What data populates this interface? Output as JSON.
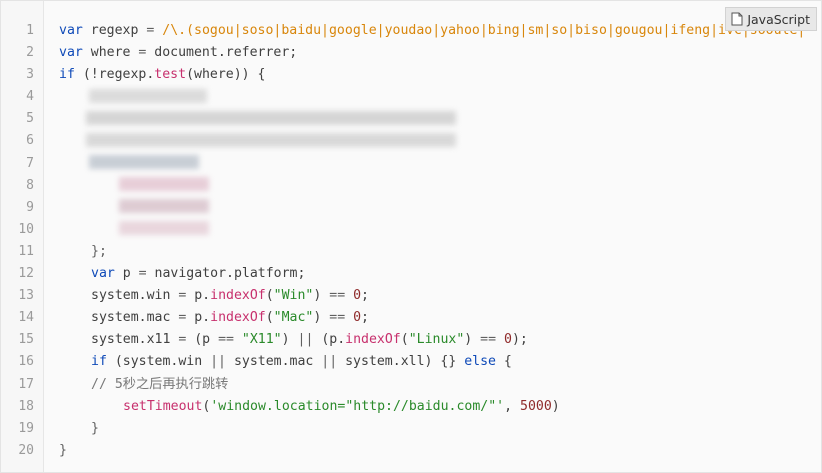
{
  "language_tag": {
    "label": "JavaScript",
    "icon": "document-icon"
  },
  "lines": [
    {
      "num": "1",
      "tokens": [
        {
          "t": "var",
          "c": "kw"
        },
        {
          "t": " regexp "
        },
        {
          "t": "=",
          "c": "op"
        },
        {
          "t": " "
        },
        {
          "t": "/\\.(sogou|soso|baidu|google|youdao|yahoo|bing|sm|so|biso|gougou|ifeng|ivc|sooule|",
          "c": "re"
        }
      ]
    },
    {
      "num": "2",
      "tokens": [
        {
          "t": "var",
          "c": "kw"
        },
        {
          "t": " where "
        },
        {
          "t": "=",
          "c": "op"
        },
        {
          "t": " document.referrer;"
        }
      ]
    },
    {
      "num": "3",
      "tokens": [
        {
          "t": "if",
          "c": "kw"
        },
        {
          "t": " (!regexp."
        },
        {
          "t": "test",
          "c": "fn"
        },
        {
          "t": "(where)) {"
        }
      ]
    },
    {
      "num": "4",
      "tokens": []
    },
    {
      "num": "5",
      "tokens": []
    },
    {
      "num": "6",
      "tokens": []
    },
    {
      "num": "7",
      "tokens": []
    },
    {
      "num": "8",
      "tokens": []
    },
    {
      "num": "9",
      "tokens": []
    },
    {
      "num": "10",
      "tokens": []
    },
    {
      "num": "11",
      "indent": 1,
      "tokens": [
        {
          "t": "};",
          "c": "op"
        }
      ]
    },
    {
      "num": "12",
      "indent": 1,
      "tokens": [
        {
          "t": "var",
          "c": "kw"
        },
        {
          "t": " p "
        },
        {
          "t": "=",
          "c": "op"
        },
        {
          "t": " navigator.platform;"
        }
      ]
    },
    {
      "num": "13",
      "indent": 1,
      "tokens": [
        {
          "t": "system.win "
        },
        {
          "t": "=",
          "c": "op"
        },
        {
          "t": " p."
        },
        {
          "t": "indexOf",
          "c": "fn"
        },
        {
          "t": "("
        },
        {
          "t": "\"Win\"",
          "c": "str"
        },
        {
          "t": ") "
        },
        {
          "t": "==",
          "c": "op"
        },
        {
          "t": " "
        },
        {
          "t": "0",
          "c": "num"
        },
        {
          "t": ";"
        }
      ]
    },
    {
      "num": "14",
      "indent": 1,
      "tokens": [
        {
          "t": "system.mac "
        },
        {
          "t": "=",
          "c": "op"
        },
        {
          "t": " p."
        },
        {
          "t": "indexOf",
          "c": "fn"
        },
        {
          "t": "("
        },
        {
          "t": "\"Mac\"",
          "c": "str"
        },
        {
          "t": ") "
        },
        {
          "t": "==",
          "c": "op"
        },
        {
          "t": " "
        },
        {
          "t": "0",
          "c": "num"
        },
        {
          "t": ";"
        }
      ]
    },
    {
      "num": "15",
      "indent": 1,
      "tokens": [
        {
          "t": "system.x11 "
        },
        {
          "t": "=",
          "c": "op"
        },
        {
          "t": " (p "
        },
        {
          "t": "==",
          "c": "op"
        },
        {
          "t": " "
        },
        {
          "t": "\"X11\"",
          "c": "str"
        },
        {
          "t": ") "
        },
        {
          "t": "||",
          "c": "op"
        },
        {
          "t": " (p."
        },
        {
          "t": "indexOf",
          "c": "fn"
        },
        {
          "t": "("
        },
        {
          "t": "\"Linux\"",
          "c": "str"
        },
        {
          "t": ") "
        },
        {
          "t": "==",
          "c": "op"
        },
        {
          "t": " "
        },
        {
          "t": "0",
          "c": "num"
        },
        {
          "t": ");"
        }
      ]
    },
    {
      "num": "16",
      "indent": 1,
      "tokens": [
        {
          "t": "if",
          "c": "kw"
        },
        {
          "t": " (system.win "
        },
        {
          "t": "||",
          "c": "op"
        },
        {
          "t": " system.mac "
        },
        {
          "t": "||",
          "c": "op"
        },
        {
          "t": " system.xll) {} "
        },
        {
          "t": "else",
          "c": "kw"
        },
        {
          "t": " {"
        }
      ]
    },
    {
      "num": "17",
      "indent": 1,
      "tokens": [
        {
          "t": "// 5秒之后再执行跳转",
          "c": "cm"
        }
      ]
    },
    {
      "num": "18",
      "indent": 2,
      "tokens": [
        {
          "t": "setTimeout",
          "c": "fn"
        },
        {
          "t": "("
        },
        {
          "t": "'window.location=\"http://baidu.com/\"'",
          "c": "str"
        },
        {
          "t": ", "
        },
        {
          "t": "5000",
          "c": "num"
        },
        {
          "t": ")"
        }
      ]
    },
    {
      "num": "19",
      "indent": 1,
      "tokens": [
        {
          "t": "}",
          "c": "op"
        }
      ]
    },
    {
      "num": "20",
      "tokens": [
        {
          "t": "}",
          "c": "op"
        }
      ]
    }
  ]
}
